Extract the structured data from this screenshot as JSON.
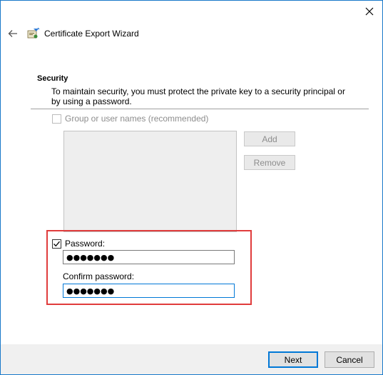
{
  "window": {
    "title": "Certificate Export Wizard",
    "close_icon": "close-icon",
    "back_icon": "back-arrow-icon",
    "wizard_icon": "certificate-wizard-icon"
  },
  "header": {
    "section_title": "Security",
    "description": "To maintain security, you must protect the private key to a security principal or by using a password."
  },
  "group": {
    "checkbox_label": "Group or user names (recommended)",
    "checked": false,
    "enabled": false,
    "list_items": [],
    "add_label": "Add",
    "remove_label": "Remove"
  },
  "password": {
    "checkbox_label": "Password:",
    "checked": true,
    "value": "●●●●●●●",
    "confirm_label": "Confirm password:",
    "confirm_value": "●●●●●●●"
  },
  "footer": {
    "next_label": "Next",
    "cancel_label": "Cancel"
  },
  "colors": {
    "window_border": "#1979ca",
    "highlight": "#e03c3c",
    "focus": "#0078d7"
  }
}
